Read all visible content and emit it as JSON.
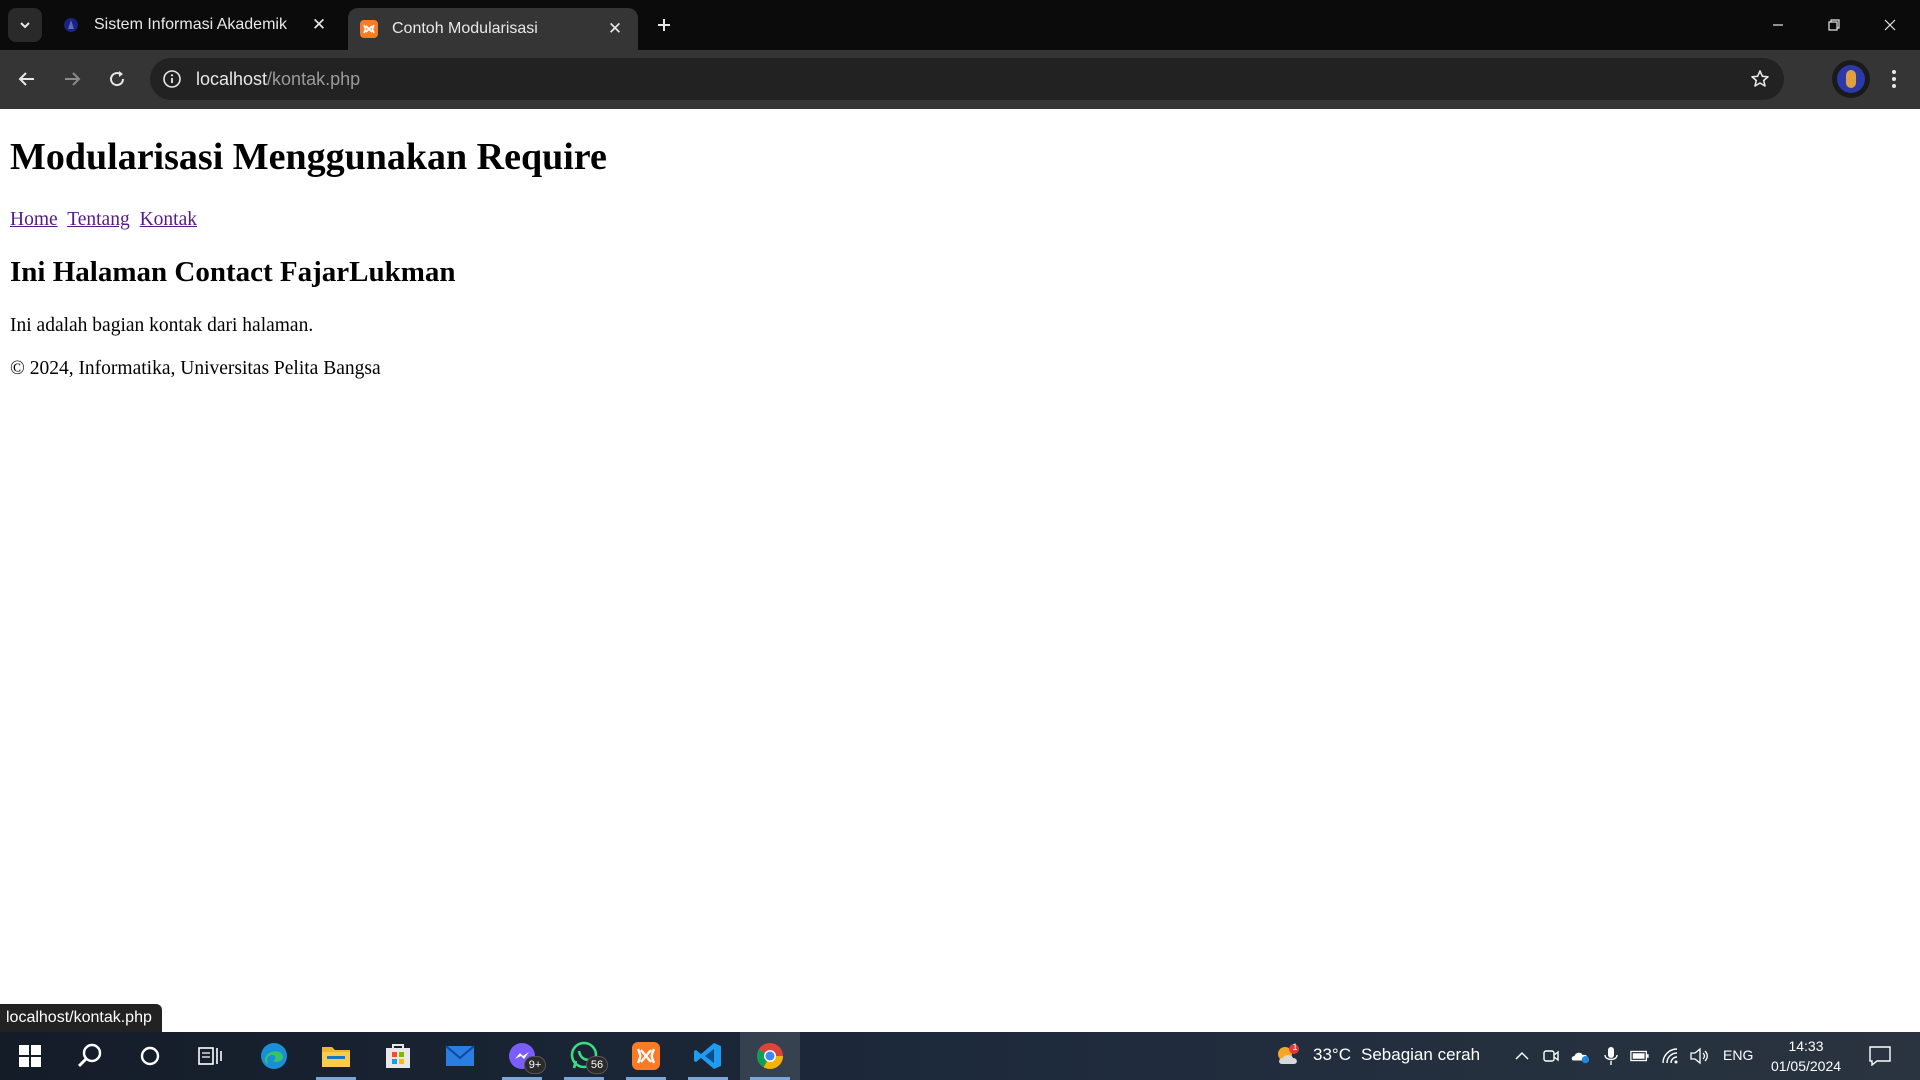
{
  "browser": {
    "tabs": [
      {
        "title": "Sistem Informasi Akademik",
        "active": false
      },
      {
        "title": "Contoh Modularisasi",
        "active": true
      }
    ],
    "address": {
      "host": "localhost",
      "path": "/kontak.php"
    }
  },
  "page": {
    "heading": "Modularisasi Menggunakan Require",
    "nav": [
      {
        "label": "Home"
      },
      {
        "label": "Tentang"
      },
      {
        "label": "Kontak"
      }
    ],
    "subheading": "Ini Halaman Contact FajarLukman",
    "content": "Ini adalah bagian kontak dari halaman.",
    "footer": "© 2024, Informatika, Universitas Pelita Bangsa"
  },
  "status_bar": {
    "url": "localhost/kontak.php"
  },
  "taskbar": {
    "apps": [
      {
        "icon": "edge-icon"
      },
      {
        "icon": "file-explorer-icon"
      },
      {
        "icon": "microsoft-store-icon"
      },
      {
        "icon": "mail-icon"
      },
      {
        "icon": "messenger-icon",
        "badge": "9+"
      },
      {
        "icon": "whatsapp-icon",
        "badge": "56"
      },
      {
        "icon": "xampp-icon"
      },
      {
        "icon": "vscode-icon"
      },
      {
        "icon": "chrome-icon"
      }
    ],
    "weather": {
      "temperature": "33°C",
      "condition": "Sebagian cerah",
      "alert_count": "1"
    },
    "language": "ENG",
    "time": "14:33",
    "date": "01/05/2024"
  },
  "colors": {
    "link_visited": "#551a8b",
    "tab_strip": "#0b0b0b",
    "toolbar": "#353535",
    "omnibox": "#222222"
  }
}
